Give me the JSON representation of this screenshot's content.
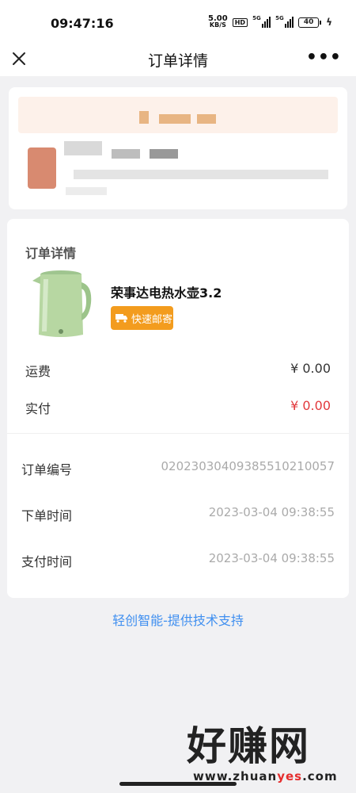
{
  "status_bar": {
    "time": "09:47:16",
    "net_speed_value": "5.00",
    "net_speed_unit": "KB/S",
    "hd_label": "HD",
    "signal1_label": "5G",
    "signal2_label": "5G",
    "battery_level": "40",
    "charging_icon": "bolt-icon"
  },
  "navbar": {
    "title": "订单详情",
    "close_icon": "close-icon",
    "more_icon": "more-icon",
    "more_glyph": "•••"
  },
  "order_detail": {
    "section_title": "订单详情",
    "product": {
      "name": "荣事达电热水壶3.2",
      "shipping_badge": "快速邮寄",
      "icon": "truck-icon"
    },
    "fee_rows": [
      {
        "label": "运费",
        "value": "¥ 0.00"
      },
      {
        "label": "实付",
        "value": "¥ 0.00"
      }
    ],
    "info_rows": [
      {
        "label": "订单编号",
        "value": "0202303040938551021005​7"
      },
      {
        "label": "下单时间",
        "value": "2023-03-04 09:38:55"
      },
      {
        "label": "支付时间",
        "value": "2023-03-04 09:38:55"
      }
    ]
  },
  "footer": {
    "support_text": "轻创智能-提供技术支持"
  },
  "watermark": {
    "main": "好赚网",
    "url_pre": "www.zhuan",
    "url_hl": "yes",
    "url_post": ".com"
  },
  "colors": {
    "accent_blue": "#3f8ff0",
    "price_red": "#e2393c",
    "badge_orange": "#f39c1e"
  }
}
